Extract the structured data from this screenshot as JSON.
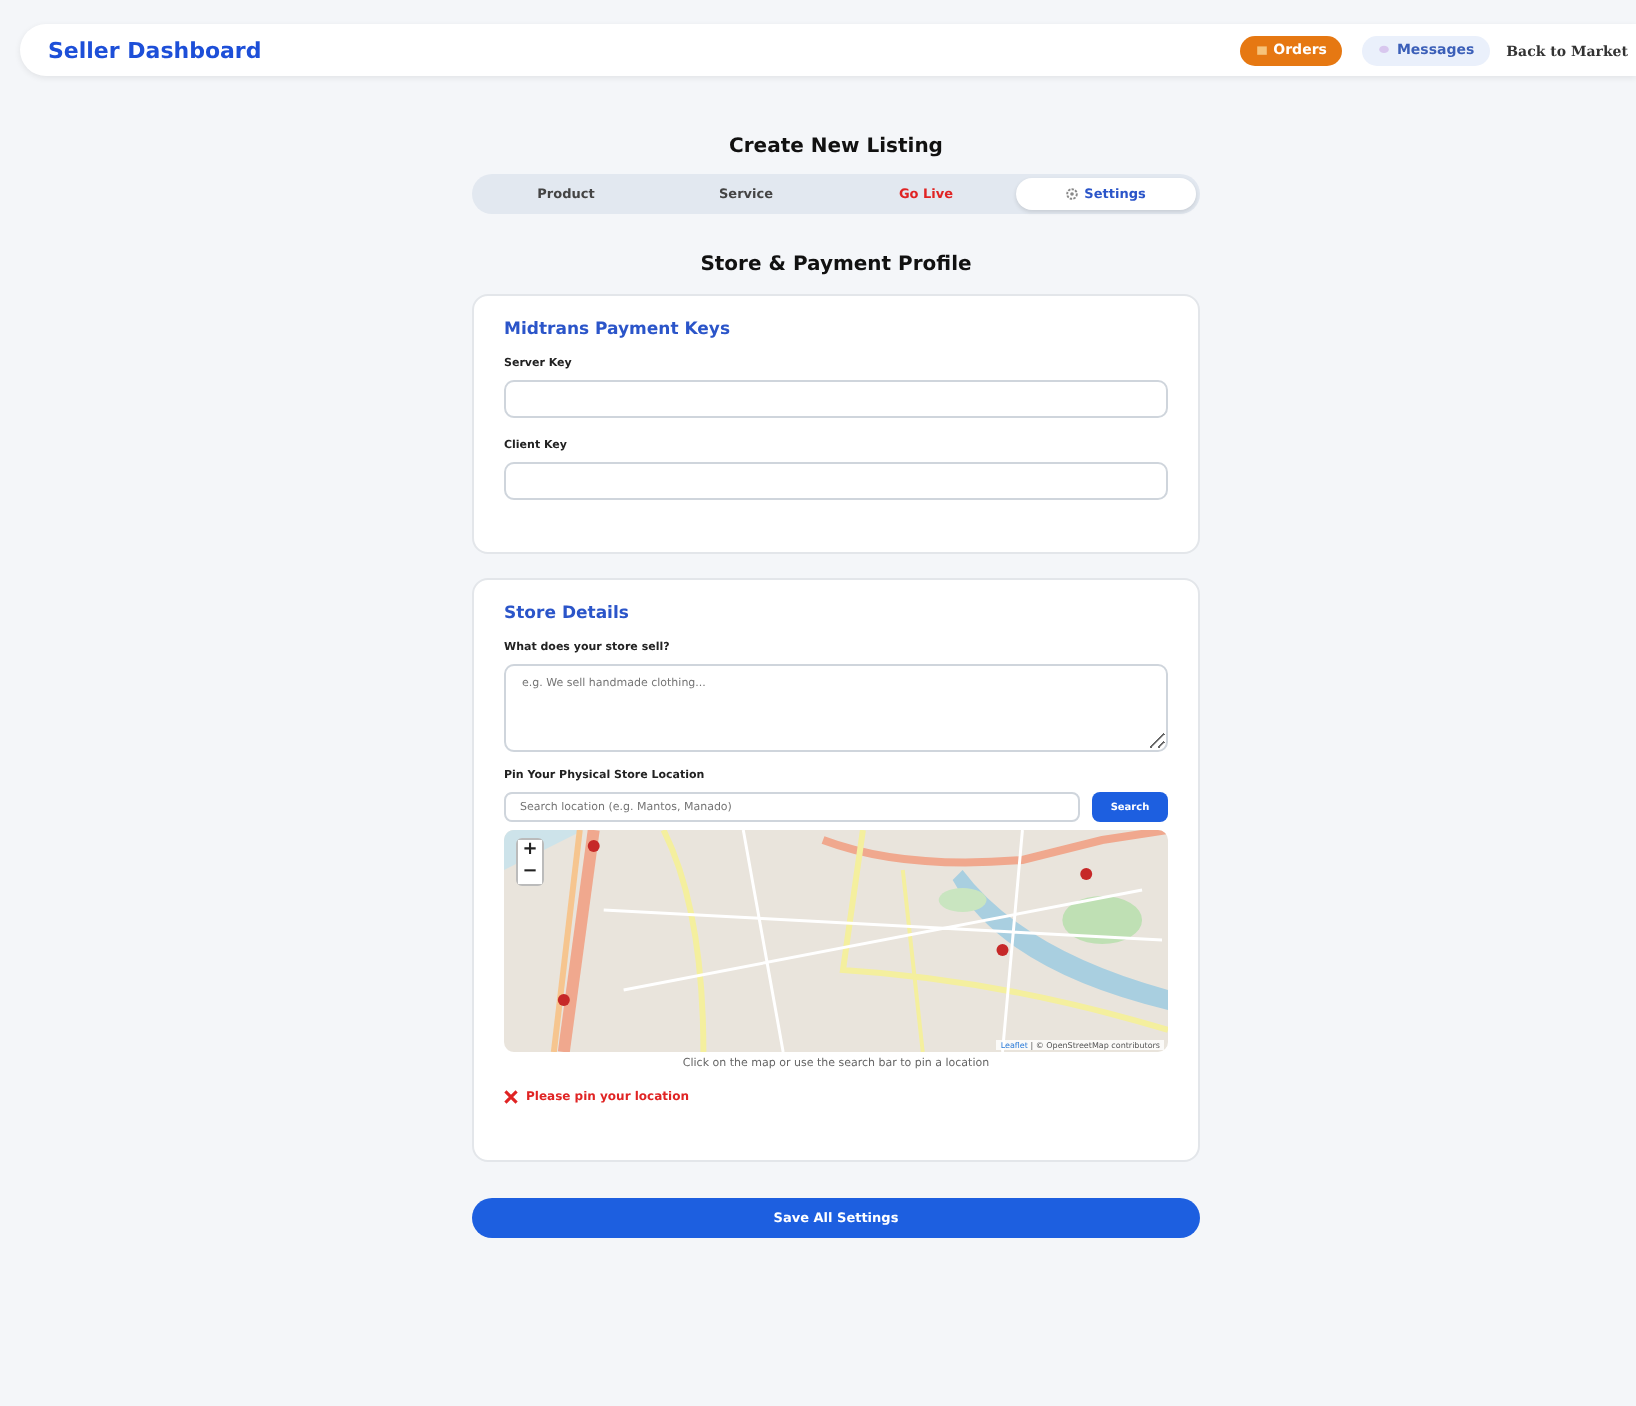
{
  "header": {
    "title": "Seller Dashboard",
    "orders": "Orders",
    "messages": "Messages",
    "back": "Back to Market"
  },
  "page_title": "Create New Listing",
  "tabs": [
    {
      "label": "Product",
      "selected": false,
      "kind": "plain"
    },
    {
      "label": "Service",
      "selected": false,
      "kind": "plain"
    },
    {
      "label": "Go Live",
      "selected": false,
      "kind": "alert"
    },
    {
      "label": "Settings",
      "selected": true,
      "kind": "gear"
    }
  ],
  "section_title": "Store & Payment Profile",
  "payment_card": {
    "title": "Midtrans Payment Keys",
    "fields": [
      {
        "label": "Server Key"
      },
      {
        "label": "Client Key"
      }
    ]
  },
  "store_card": {
    "title": "Store Details",
    "sell_label": "What does your store sell?",
    "sell_placeholder": "e.g. We sell handmade clothing...",
    "location_label": "Pin Your Physical Store Location",
    "search_placeholder": "Search location (e.g. Mantos, Manado)",
    "search_button": "Search",
    "map": {
      "kind": "picture",
      "zoom_in": "+",
      "zoom_out": "−",
      "attribution_link": "Leaflet",
      "attribution": "| © OpenStreetMap contributors"
    },
    "hint": "Click on the map or use the search bar to pin a location",
    "error": "Please pin your location"
  },
  "save_button": "Save All Settings"
}
